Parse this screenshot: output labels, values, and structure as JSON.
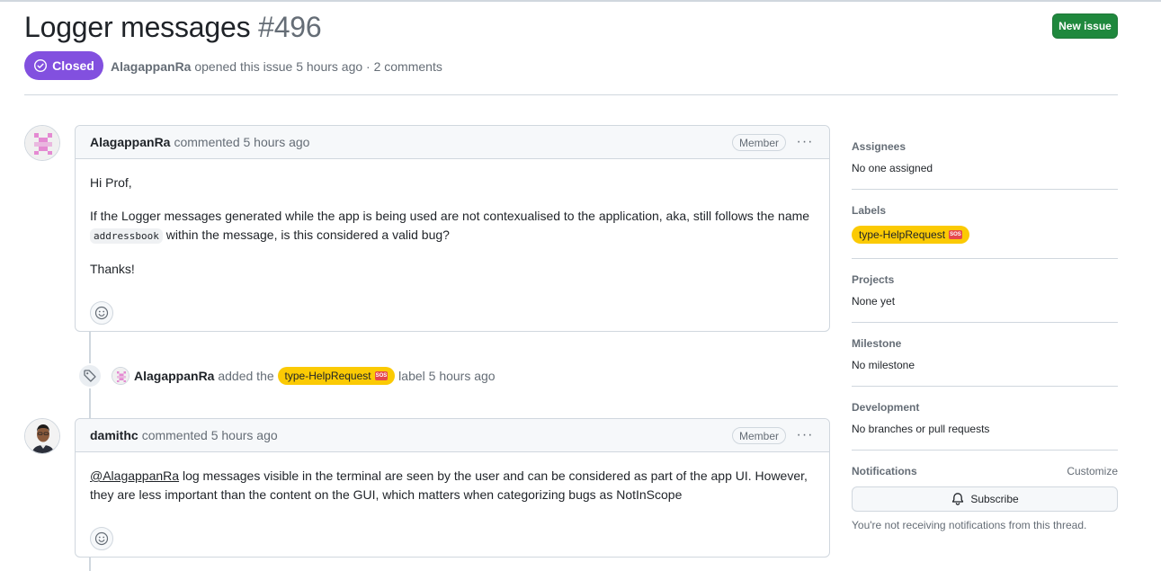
{
  "issue": {
    "title": "Logger messages",
    "number": "#496",
    "state": "Closed",
    "author": "AlagappanRa",
    "meta_rest": "opened this issue 5 hours ago · 2 comments",
    "new_issue_label": "New issue"
  },
  "comments": [
    {
      "author": "AlagappanRa",
      "action": "commented 5 hours ago",
      "role": "Member",
      "body": {
        "greeting": "Hi Prof,",
        "line1_pre": "If the Logger messages generated while the app is being used are not contexualised to the application, aka, still follows the name",
        "code": "addressbook",
        "line1_post": "within the message, is this considered a valid bug?",
        "closing": "Thanks!"
      }
    },
    {
      "author": "damithc",
      "action": "commented 5 hours ago",
      "role": "Member",
      "body": {
        "mention": "@AlagappanRa",
        "text": "log messages visible in the terminal are seen by the user and can be considered as part of the app UI. However, they are less important than the content on the GUI, which matters when categorizing bugs as NotInScope"
      }
    }
  ],
  "event": {
    "actor": "AlagappanRa",
    "verb": "added the",
    "label": "type-HelpRequest",
    "label_emoji": "SOS",
    "suffix": "label 5 hours ago"
  },
  "sidebar": {
    "assignees": {
      "heading": "Assignees",
      "value": "No one assigned"
    },
    "labels": {
      "heading": "Labels",
      "label": "type-HelpRequest",
      "emoji": "SOS"
    },
    "projects": {
      "heading": "Projects",
      "value": "None yet"
    },
    "milestone": {
      "heading": "Milestone",
      "value": "No milestone"
    },
    "development": {
      "heading": "Development",
      "value": "No branches or pull requests"
    },
    "notifications": {
      "heading": "Notifications",
      "customize": "Customize",
      "button": "Subscribe",
      "note": "You're not receiving notifications from this thread."
    }
  },
  "colors": {
    "closed": "#8250df",
    "new_issue": "#1f883d",
    "label": "#fbca04",
    "identicon": "#e48ad2"
  }
}
